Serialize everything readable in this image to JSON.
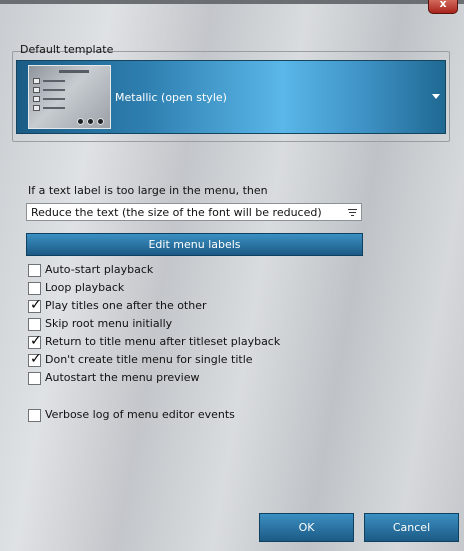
{
  "window": {
    "close_glyph": "x"
  },
  "template": {
    "group_title": "Default template",
    "selected": "Metallic (open style)",
    "thumbnail_icon": "metallic-template-thumbnail"
  },
  "text_label": {
    "question": "If a text label is too large in the menu, then",
    "selected": "Reduce the text (the size of the font will be reduced)"
  },
  "edit_labels_button": "Edit menu labels",
  "options": [
    {
      "label": "Auto-start playback",
      "checked": false
    },
    {
      "label": "Loop playback",
      "checked": false
    },
    {
      "label": "Play titles one after the other",
      "checked": true
    },
    {
      "label": "Skip root menu initially",
      "checked": false
    },
    {
      "label": "Return to title menu after titleset playback",
      "checked": true
    },
    {
      "label": "Don't create title menu for single title",
      "checked": true
    },
    {
      "label": "Autostart the menu preview",
      "checked": false
    }
  ],
  "verbose": {
    "label": "Verbose log of menu editor events",
    "checked": false
  },
  "footer": {
    "ok": "OK",
    "cancel": "Cancel"
  },
  "colors": {
    "accent_blue": "#2e7fb0",
    "close_red": "#b8352a"
  }
}
